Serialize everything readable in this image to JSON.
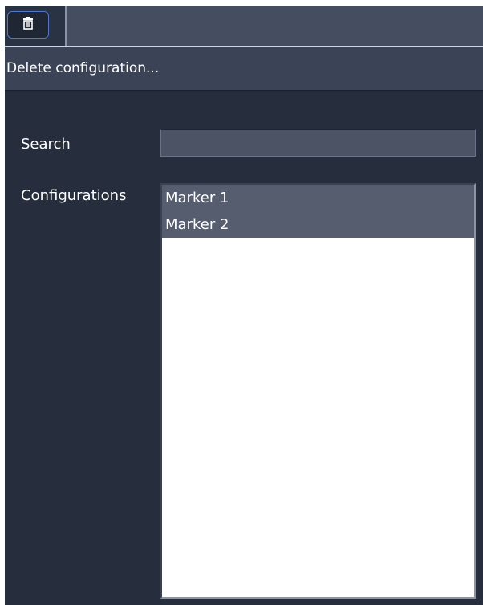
{
  "toolbar": {
    "delete_icon": "trash-icon"
  },
  "header": {
    "title": "Delete configuration..."
  },
  "form": {
    "search_label": "Search",
    "search_value": "",
    "configurations_label": "Configurations",
    "configurations": [
      {
        "label": "Marker 1",
        "selected": true
      },
      {
        "label": "Marker 2",
        "selected": true
      }
    ]
  },
  "colors": {
    "panel_background": "#262e3d",
    "header_background": "#3b4457",
    "toolbar_background": "#454e61",
    "button_border_accent": "#4f79c6",
    "selected_item_background": "#555d6f",
    "list_background": "#ffffff"
  }
}
